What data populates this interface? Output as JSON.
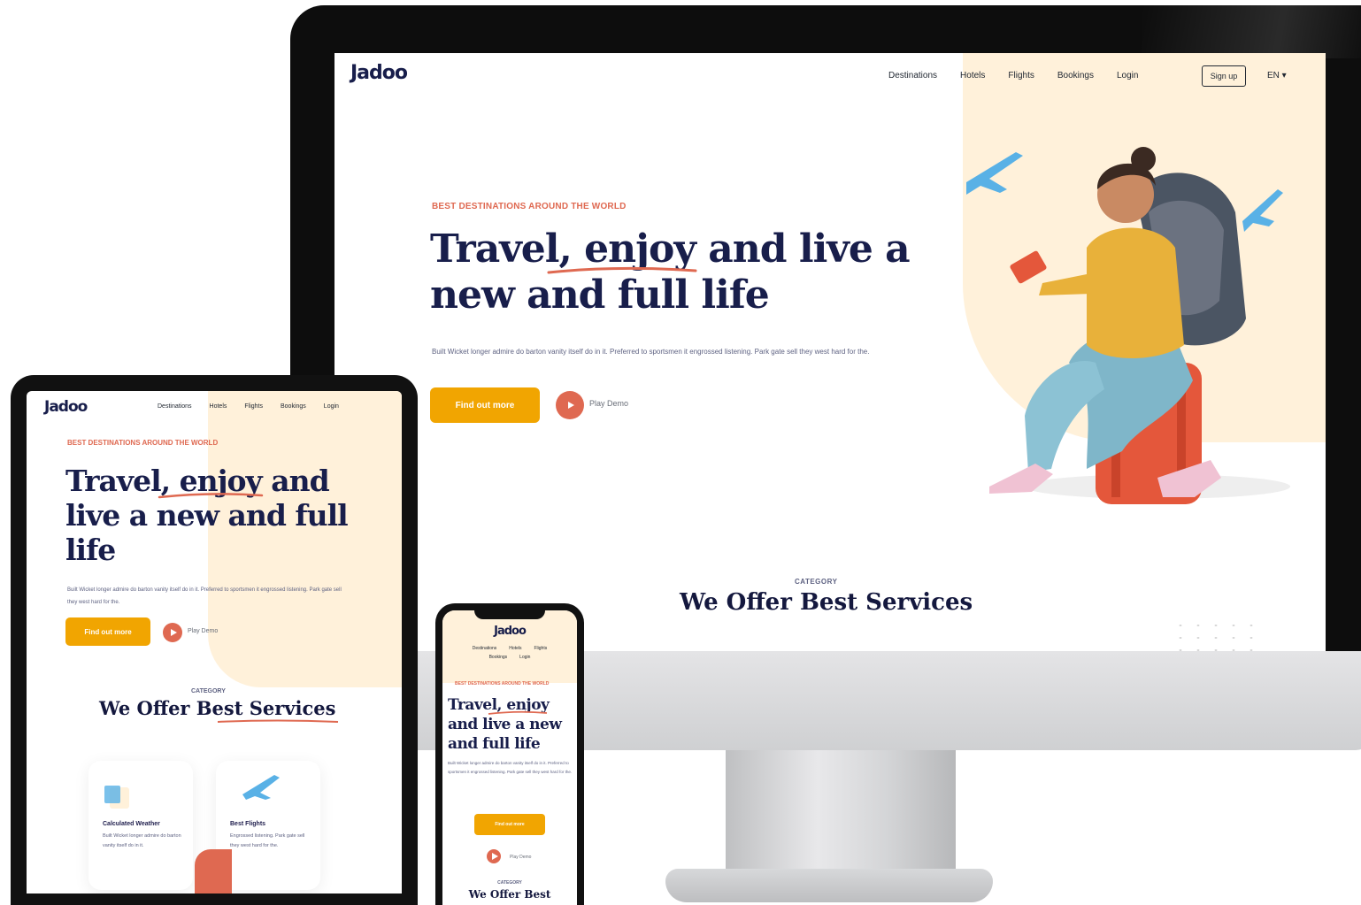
{
  "brand": {
    "logo": "Jadoo"
  },
  "colors": {
    "accent_yellow": "#f1a501",
    "accent_red": "#df6951",
    "navy": "#181e4b",
    "cream": "#fff1da"
  },
  "desktop": {
    "nav": [
      "Destinations",
      "Hotels",
      "Flights",
      "Bookings",
      "Login"
    ],
    "signup": "Sign up",
    "lang": "EN ▾",
    "eyebrow": "BEST DESTINATIONS AROUND THE WORLD",
    "title": "Travel, enjoy and live a new and full life",
    "description": "Built Wicket longer admire do barton vanity itself do in it. Preferred to sportsmen it engrossed listening. Park gate sell they west hard for the.",
    "cta": "Find out more",
    "play": "Play Demo",
    "category": "CATEGORY",
    "services_title": "We Offer Best Services"
  },
  "tablet": {
    "nav": [
      "Destinations",
      "Hotels",
      "Flights",
      "Bookings",
      "Login"
    ],
    "eyebrow": "BEST DESTINATIONS AROUND THE WORLD",
    "title": "Travel, enjoy and live a new and full life",
    "description": "Built Wicket longer admire do barton vanity itself do in it. Preferred to sportsmen it engrossed listening. Park gate sell they west hard for the.",
    "cta": "Find out more",
    "play": "Play Demo",
    "category": "CATEGORY",
    "services_title": "We Offer Best Services",
    "cards": [
      {
        "title": "Calculated Weather",
        "desc": "Built Wicket longer admire do barton vanity itself do in it."
      },
      {
        "title": "Best Flights",
        "desc": "Engrossed listening. Park gate sell they west hard for the."
      }
    ]
  },
  "phone": {
    "nav_row1": [
      "Destinations",
      "Hotels",
      "Flights"
    ],
    "nav_row2": [
      "Bookings",
      "Login"
    ],
    "eyebrow": "BEST DESTINATIONS AROUND THE WORLD",
    "title": "Travel, enjoy and live a new and full life",
    "description": "Built Wicket longer admire do barton vanity itself do in it. Preferred to sportsmen it engrossed listening. Park gate sell they west hard for the.",
    "cta": "Find out more",
    "play": "Play Demo",
    "category": "CATEGORY",
    "services_title": "We Offer Best"
  }
}
